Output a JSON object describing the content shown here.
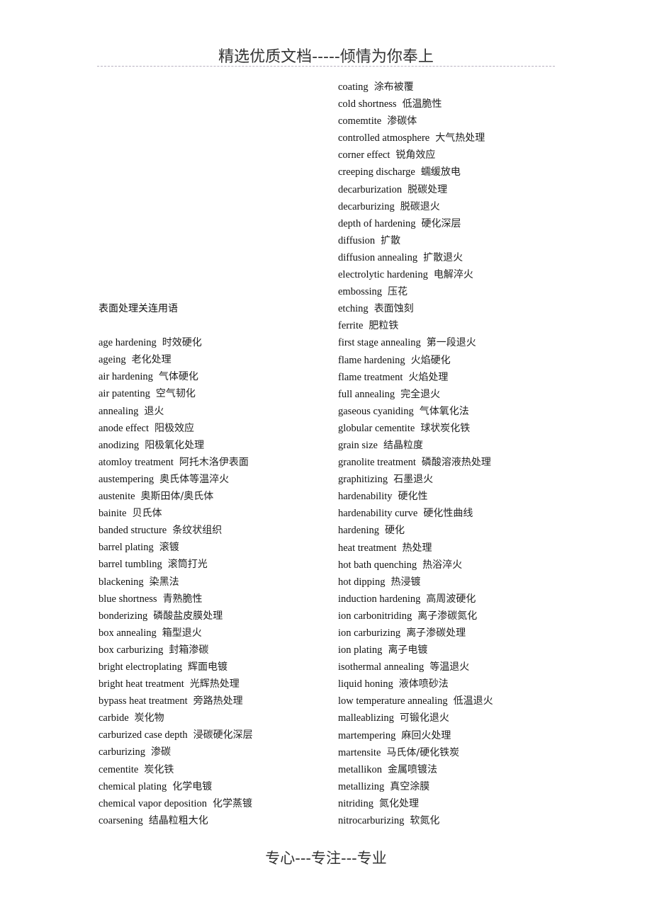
{
  "header": {
    "title": "精选优质文档-----倾情为你奉上"
  },
  "footer": {
    "text": "专心---专注---专业"
  },
  "left_column": {
    "section_title": "表面处理关连用语",
    "entries": [
      {
        "en": "age hardening",
        "zh": "时效硬化"
      },
      {
        "en": "ageing",
        "zh": "老化处理"
      },
      {
        "en": "air hardening",
        "zh": "气体硬化"
      },
      {
        "en": "air patenting",
        "zh": "空气韧化"
      },
      {
        "en": "annealing",
        "zh": "退火"
      },
      {
        "en": "anode effect",
        "zh": "阳极效应"
      },
      {
        "en": "anodizing",
        "zh": "阳极氧化处理"
      },
      {
        "en": "atomloy treatment",
        "zh": "阿托木洛伊表面"
      },
      {
        "en": "austempering",
        "zh": "奥氏体等温淬火"
      },
      {
        "en": "austenite",
        "zh": "奥斯田体/奥氏体"
      },
      {
        "en": "bainite",
        "zh": "贝氏体"
      },
      {
        "en": "banded structure",
        "zh": "条纹状组织"
      },
      {
        "en": "barrel plating",
        "zh": "滚镀"
      },
      {
        "en": "barrel tumbling",
        "zh": "滚筒打光"
      },
      {
        "en": "blackening",
        "zh": "染黑法"
      },
      {
        "en": "blue shortness",
        "zh": "青熟脆性"
      },
      {
        "en": "bonderizing",
        "zh": "磷酸盐皮膜处理"
      },
      {
        "en": "box annealing",
        "zh": "箱型退火"
      },
      {
        "en": "box carburizing",
        "zh": "封箱渗碳"
      },
      {
        "en": "bright electroplating",
        "zh": "辉面电镀"
      },
      {
        "en": "bright heat treatment",
        "zh": "光辉热处理"
      },
      {
        "en": "bypass heat treatment",
        "zh": "旁路热处理"
      },
      {
        "en": "carbide",
        "zh": "炭化物"
      },
      {
        "en": "carburized case depth",
        "zh": "浸碳硬化深层"
      },
      {
        "en": "carburizing",
        "zh": "渗碳"
      },
      {
        "en": "cementite",
        "zh": "炭化铁"
      },
      {
        "en": "chemical plating",
        "zh": "化学电镀"
      },
      {
        "en": "chemical vapor deposition",
        "zh": "化学蒸镀"
      },
      {
        "en": "coarsening",
        "zh": "结晶粒粗大化"
      }
    ]
  },
  "right_column": {
    "entries": [
      {
        "en": "coating",
        "zh": "涂布被覆"
      },
      {
        "en": "cold shortness",
        "zh": "低温脆性"
      },
      {
        "en": "comemtite",
        "zh": "渗碳体"
      },
      {
        "en": "controlled atmosphere",
        "zh": "大气热处理"
      },
      {
        "en": "corner effect",
        "zh": "锐角效应"
      },
      {
        "en": "creeping discharge",
        "zh": "蠕缓放电"
      },
      {
        "en": "decarburization",
        "zh": "脱碳处理"
      },
      {
        "en": "decarburizing",
        "zh": "脱碳退火"
      },
      {
        "en": "depth of hardening",
        "zh": "硬化深层"
      },
      {
        "en": "diffusion",
        "zh": "扩散"
      },
      {
        "en": "diffusion annealing",
        "zh": "扩散退火"
      },
      {
        "en": "electrolytic hardening",
        "zh": "电解淬火"
      },
      {
        "en": "embossing",
        "zh": "压花"
      },
      {
        "en": "etching",
        "zh": "表面蚀刻"
      },
      {
        "en": "ferrite",
        "zh": "肥粒铁"
      },
      {
        "en": "first stage annealing",
        "zh": "第一段退火"
      },
      {
        "en": "flame hardening",
        "zh": "火焰硬化"
      },
      {
        "en": "flame treatment",
        "zh": "火焰处理"
      },
      {
        "en": "full annealing",
        "zh": "完全退火"
      },
      {
        "en": "gaseous cyaniding",
        "zh": "气体氧化法"
      },
      {
        "en": "globular cementite",
        "zh": "球状炭化铁"
      },
      {
        "en": "grain size",
        "zh": "结晶粒度"
      },
      {
        "en": "granolite treatment",
        "zh": "磷酸溶液热处理"
      },
      {
        "en": "graphitizing",
        "zh": "石墨退火"
      },
      {
        "en": "hardenability",
        "zh": "硬化性"
      },
      {
        "en": "hardenability curve",
        "zh": "硬化性曲线"
      },
      {
        "en": "hardening",
        "zh": "硬化"
      },
      {
        "en": "heat treatment",
        "zh": "热处理"
      },
      {
        "en": "hot bath quenching",
        "zh": "热浴淬火"
      },
      {
        "en": "hot dipping",
        "zh": "热浸镀"
      },
      {
        "en": "induction hardening",
        "zh": "高周波硬化"
      },
      {
        "en": "ion carbonitriding",
        "zh": "离子渗碳氮化"
      },
      {
        "en": "ion carburizing",
        "zh": "离子渗碳处理"
      },
      {
        "en": "ion plating",
        "zh": "离子电镀"
      },
      {
        "en": "isothermal annealing",
        "zh": "等温退火"
      },
      {
        "en": "liquid honing",
        "zh": "液体喷砂法"
      },
      {
        "en": "low temperature annealing",
        "zh": "低温退火"
      },
      {
        "en": "malleablizing",
        "zh": "可锻化退火"
      },
      {
        "en": "martempering",
        "zh": "麻回火处理"
      },
      {
        "en": "martensite",
        "zh": "马氏体/硬化铁炭"
      },
      {
        "en": "metallikon",
        "zh": "金属喷镀法"
      },
      {
        "en": "metallizing",
        "zh": "真空涂膜"
      },
      {
        "en": "nitriding",
        "zh": "氮化处理"
      },
      {
        "en": "nitrocarburizing",
        "zh": "软氮化"
      }
    ]
  }
}
